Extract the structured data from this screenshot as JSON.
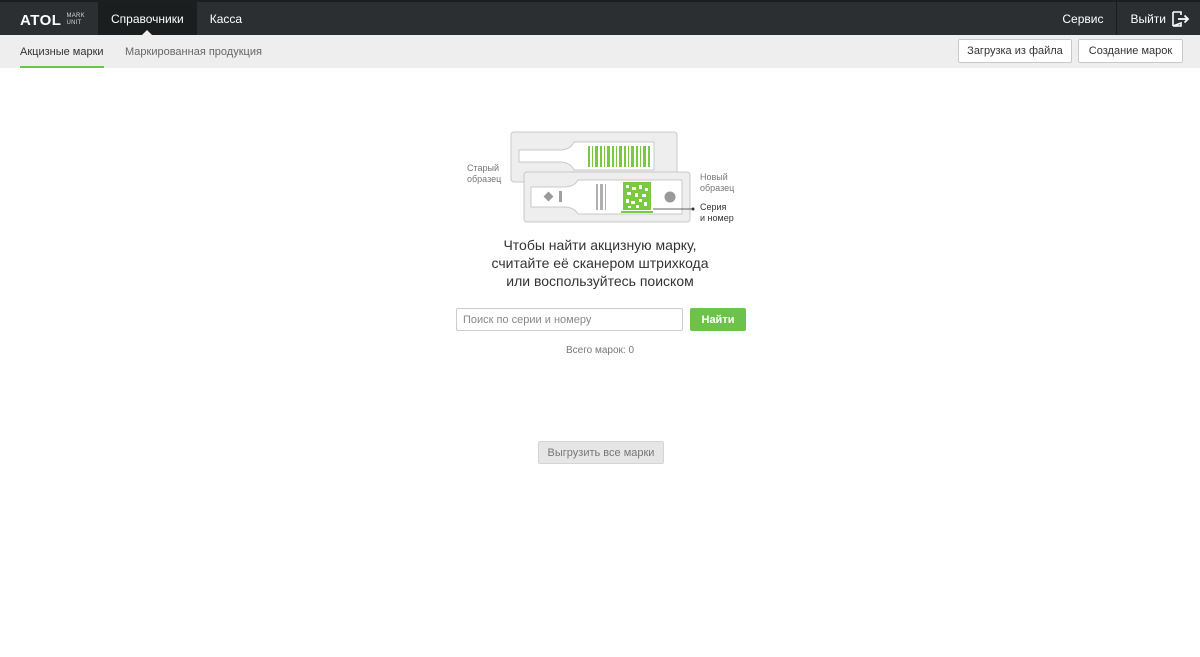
{
  "brand": {
    "name": "ATOL",
    "sub_line1": "MARK",
    "sub_line2": "UNIT"
  },
  "topnav": {
    "items": [
      {
        "label": "Справочники",
        "active": true
      },
      {
        "label": "Касса",
        "active": false
      }
    ],
    "service_label": "Сервис",
    "logout_label": "Выйти"
  },
  "subnav": {
    "tabs": [
      {
        "label": "Акцизные марки",
        "active": true
      },
      {
        "label": "Маркированная продукция",
        "active": false
      }
    ],
    "upload_button": "Загрузка из файла",
    "create_button": "Создание марок"
  },
  "illustration": {
    "old_label_line1": "Старый",
    "old_label_line2": "образец",
    "new_label_line1": "Новый",
    "new_label_line2": "образец",
    "series_label_line1": "Серия",
    "series_label_line2": "и номер"
  },
  "main": {
    "headline": [
      "Чтобы найти акцизную марку,",
      "считайте её сканером штрихкода",
      "или воспользуйтесь поиском"
    ],
    "search": {
      "placeholder": "Поиск по серии и номеру",
      "value": ""
    },
    "find_button": "Найти",
    "total_label": "Всего марок: 0",
    "export_button": "Выгрузить все марки"
  },
  "colors": {
    "accent": "#6cc24a",
    "topbar": "#2b2f31",
    "subbar": "#eeeeee"
  }
}
